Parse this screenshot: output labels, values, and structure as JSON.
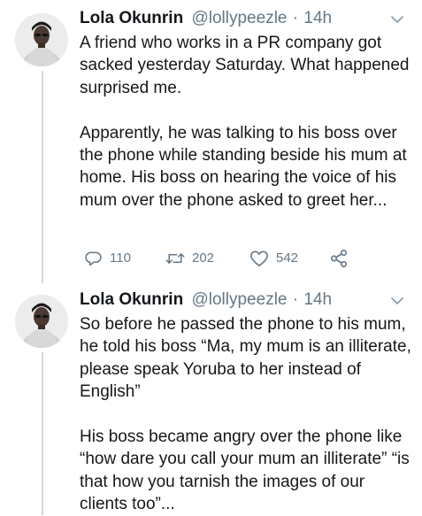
{
  "tweets": [
    {
      "author": {
        "name": "Lola Okunrin",
        "handle": "@lollypeezle",
        "separator": "·",
        "time": "14h"
      },
      "paragraphs": [
        "A friend who works in a PR company got sacked yesterday Saturday. What happened surprised me.",
        "Apparently, he was talking to his boss over the phone while standing beside his mum at home. His boss on hearing the voice of his mum over the phone asked to greet her..."
      ],
      "actions": {
        "replies": "110",
        "retweets": "202",
        "likes": "542"
      }
    },
    {
      "author": {
        "name": "Lola Okunrin",
        "handle": "@lollypeezle",
        "separator": "·",
        "time": "14h"
      },
      "paragraphs": [
        "So before he passed the phone to his mum, he told his boss “Ma, my mum is an illiterate, please speak Yoruba to her instead of English”",
        "His boss became angry over the phone like “how dare you call your mum an illiterate” “is that how you tarnish the images of our clients too”..."
      ]
    }
  ],
  "icons": {
    "reply": "reply-icon",
    "retweet": "retweet-icon",
    "like": "heart-icon",
    "share": "share-icon",
    "menu": "chevron-down-icon"
  },
  "colors": {
    "text": "#14171a",
    "muted": "#657786",
    "thread_line": "#cfd9de"
  }
}
